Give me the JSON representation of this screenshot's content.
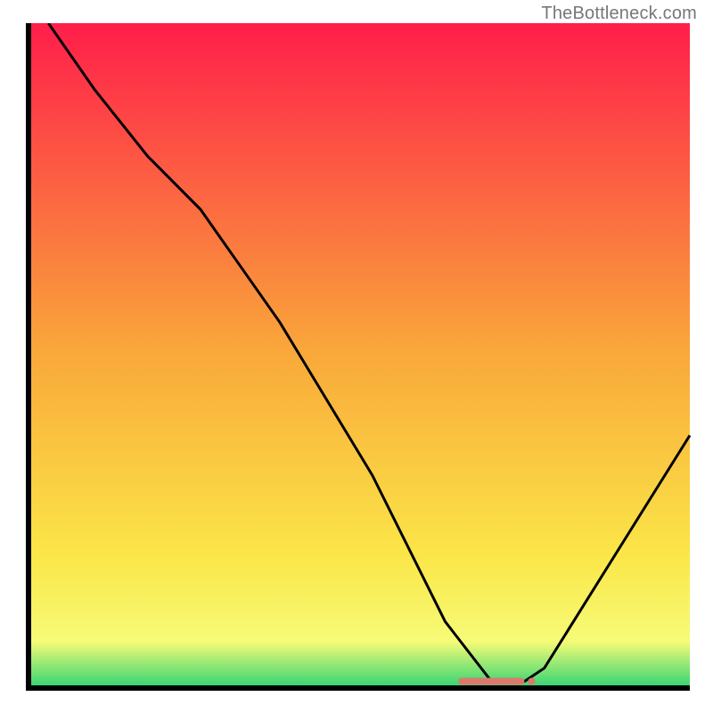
{
  "watermark": "TheBottleneck.com",
  "chart_data": {
    "type": "line",
    "title": "",
    "xlabel": "",
    "ylabel": "",
    "xlim": [
      0,
      100
    ],
    "ylim": [
      0,
      100
    ],
    "grid": false,
    "background": {
      "type": "gradient",
      "stops": [
        {
          "offset": 0,
          "color": "#ff1e4a"
        },
        {
          "offset": 50,
          "color": "#f9a93a"
        },
        {
          "offset": 80,
          "color": "#fbe648"
        },
        {
          "offset": 93,
          "color": "#f6fb77"
        },
        {
          "offset": 100,
          "color": "#2fd373"
        }
      ]
    },
    "series": [
      {
        "name": "bottleneck-curve",
        "x": [
          3,
          10,
          18,
          26,
          38,
          52,
          63,
          70,
          75,
          78,
          100
        ],
        "y": [
          100,
          90,
          80,
          72,
          55,
          32,
          10,
          1,
          1,
          3,
          38
        ]
      }
    ],
    "marker": {
      "name": "optimal-range",
      "x_start": 65,
      "x_end": 75,
      "y": 1,
      "color": "#d97a6c"
    }
  }
}
